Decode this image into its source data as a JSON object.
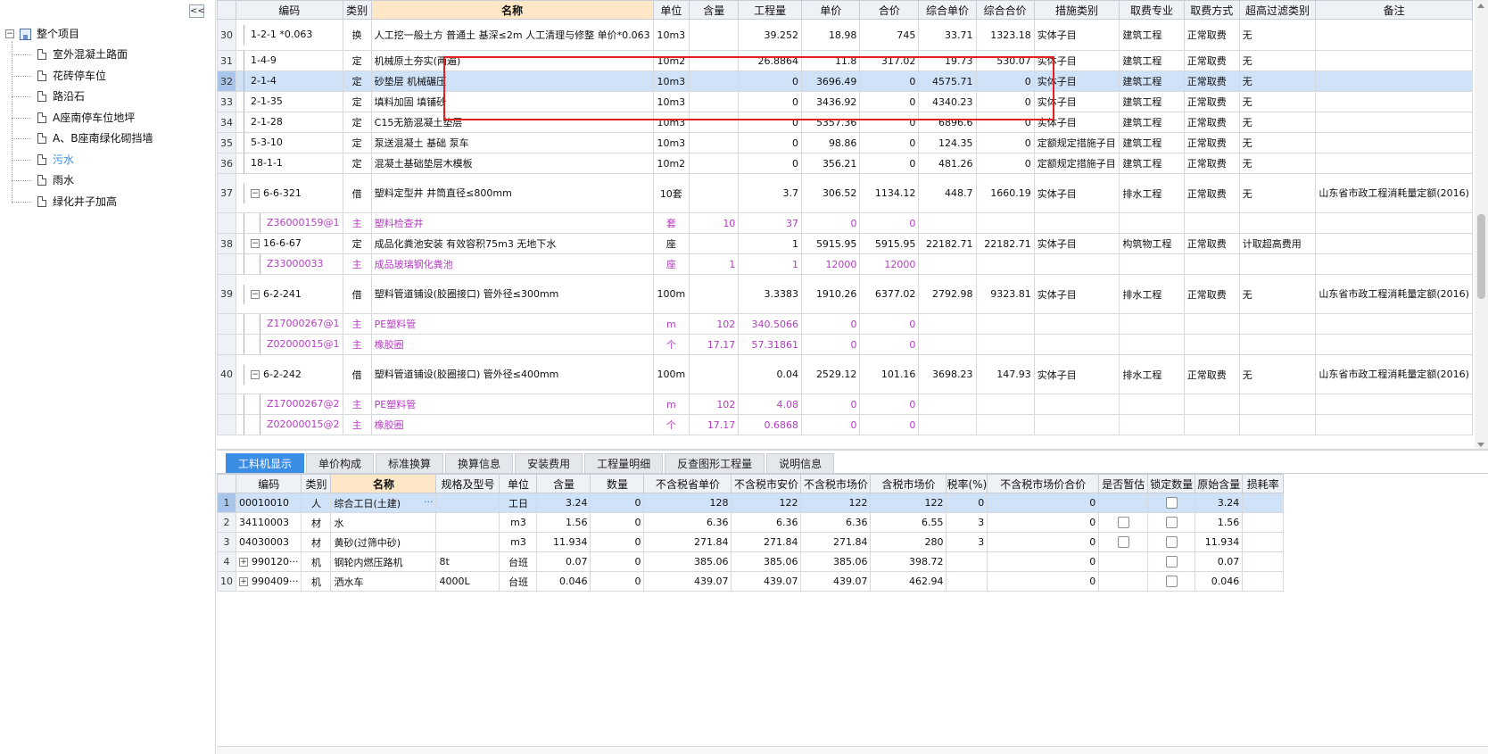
{
  "tree": {
    "collapse_label": "<<",
    "root": "整个项目",
    "items": [
      {
        "label": "室外混凝土路面",
        "active": false
      },
      {
        "label": "花砖停车位",
        "active": false
      },
      {
        "label": "路沿石",
        "active": false
      },
      {
        "label": "A座南停车位地坪",
        "active": false
      },
      {
        "label": "A、B座南绿化砌挡墙",
        "active": false
      },
      {
        "label": "污水",
        "active": true
      },
      {
        "label": "雨水",
        "active": false
      },
      {
        "label": "绿化井子加高",
        "active": false
      }
    ]
  },
  "upper_headers": [
    "",
    "编码",
    "类别",
    "名称",
    "单位",
    "含量",
    "工程量",
    "单价",
    "合价",
    "综合单价",
    "综合合价",
    "措施类别",
    "取费专业",
    "取费方式",
    "超高过滤类别",
    "备注"
  ],
  "upper_rows": [
    {
      "rn": "30",
      "code": "1-2-1 *0.063",
      "type": "换",
      "name": "人工挖一般土方 普通土 基深≤2m 人工清理与修整 单价*0.063",
      "unit": "10m3",
      "content": "",
      "qty": "39.252",
      "price": "18.98",
      "total": "745",
      "cprice": "33.71",
      "ctotal": "1323.18",
      "measure": "实体子目",
      "major": "建筑工程",
      "mode": "正常取费",
      "filter": "无",
      "note": "",
      "kind": "tall",
      "toggle": ""
    },
    {
      "rn": "31",
      "code": "1-4-9",
      "type": "定",
      "name": "机械原土夯实(两遍)",
      "unit": "10m2",
      "content": "",
      "qty": "26.8864",
      "price": "11.8",
      "total": "317.02",
      "cprice": "19.73",
      "ctotal": "530.07",
      "measure": "实体子目",
      "major": "建筑工程",
      "mode": "正常取费",
      "filter": "无",
      "note": "",
      "kind": "",
      "toggle": ""
    },
    {
      "rn": "32",
      "code": "2-1-4",
      "type": "定",
      "name": "砂垫层 机械碾压",
      "unit": "10m3",
      "content": "",
      "qty": "0",
      "price": "3696.49",
      "total": "0",
      "cprice": "4575.71",
      "ctotal": "0",
      "measure": "实体子目",
      "major": "建筑工程",
      "mode": "正常取费",
      "filter": "无",
      "note": "",
      "kind": "sel",
      "toggle": ""
    },
    {
      "rn": "33",
      "code": "2-1-35",
      "type": "定",
      "name": "填料加固 填铺砂",
      "unit": "10m3",
      "content": "",
      "qty": "0",
      "price": "3436.92",
      "total": "0",
      "cprice": "4340.23",
      "ctotal": "0",
      "measure": "实体子目",
      "major": "建筑工程",
      "mode": "正常取费",
      "filter": "无",
      "note": "",
      "kind": "",
      "toggle": ""
    },
    {
      "rn": "34",
      "code": "2-1-28",
      "type": "定",
      "name": "C15无筋混凝土垫层",
      "unit": "10m3",
      "content": "",
      "qty": "0",
      "price": "5357.36",
      "total": "0",
      "cprice": "6896.6",
      "ctotal": "0",
      "measure": "实体子目",
      "major": "建筑工程",
      "mode": "正常取费",
      "filter": "无",
      "note": "",
      "kind": "",
      "toggle": ""
    },
    {
      "rn": "35",
      "code": "5-3-10",
      "type": "定",
      "name": "泵送混凝土 基础 泵车",
      "unit": "10m3",
      "content": "",
      "qty": "0",
      "price": "98.86",
      "total": "0",
      "cprice": "124.35",
      "ctotal": "0",
      "measure": "定额规定措施子目",
      "major": "建筑工程",
      "mode": "正常取费",
      "filter": "无",
      "note": "",
      "kind": "",
      "toggle": ""
    },
    {
      "rn": "36",
      "code": "18-1-1",
      "type": "定",
      "name": "混凝土基础垫层木模板",
      "unit": "10m2",
      "content": "",
      "qty": "0",
      "price": "356.21",
      "total": "0",
      "cprice": "481.26",
      "ctotal": "0",
      "measure": "定额规定措施子目",
      "major": "建筑工程",
      "mode": "正常取费",
      "filter": "无",
      "note": "",
      "kind": "",
      "toggle": ""
    },
    {
      "rn": "37",
      "code": "6-6-321",
      "type": "借",
      "name": "塑料定型井 井筒直径≤800mm",
      "unit": "10套",
      "content": "",
      "qty": "3.7",
      "price": "306.52",
      "total": "1134.12",
      "cprice": "448.7",
      "ctotal": "1660.19",
      "measure": "实体子目",
      "major": "排水工程",
      "mode": "正常取费",
      "filter": "无",
      "note": "山东省市政工程消耗量定额(2016)",
      "kind": "tall",
      "toggle": "−"
    },
    {
      "rn": "",
      "code": "Z36000159@1",
      "type": "主",
      "name": "塑料检查井",
      "unit": "套",
      "content": "10",
      "qty": "37",
      "price": "0",
      "total": "0",
      "cprice": "",
      "ctotal": "",
      "measure": "",
      "major": "",
      "mode": "",
      "filter": "",
      "note": "",
      "kind": "sub",
      "toggle": ""
    },
    {
      "rn": "38",
      "code": "16-6-67",
      "type": "定",
      "name": "成品化粪池安装 有效容积75m3 无地下水",
      "unit": "座",
      "content": "",
      "qty": "1",
      "price": "5915.95",
      "total": "5915.95",
      "cprice": "22182.71",
      "ctotal": "22182.71",
      "measure": "实体子目",
      "major": "构筑物工程",
      "mode": "正常取费",
      "filter": "计取超高费用",
      "note": "",
      "kind": "",
      "toggle": "−"
    },
    {
      "rn": "",
      "code": "Z33000033",
      "type": "主",
      "name": "成品玻璃钢化粪池",
      "unit": "座",
      "content": "1",
      "qty": "1",
      "price": "12000",
      "total": "12000",
      "cprice": "",
      "ctotal": "",
      "measure": "",
      "major": "",
      "mode": "",
      "filter": "",
      "note": "",
      "kind": "sub",
      "toggle": ""
    },
    {
      "rn": "39",
      "code": "6-2-241",
      "type": "借",
      "name": "塑料管道铺设(胶圈接口) 管外径≤300mm",
      "unit": "100m",
      "content": "",
      "qty": "3.3383",
      "price": "1910.26",
      "total": "6377.02",
      "cprice": "2792.98",
      "ctotal": "9323.81",
      "measure": "实体子目",
      "major": "排水工程",
      "mode": "正常取费",
      "filter": "无",
      "note": "山东省市政工程消耗量定额(2016)",
      "kind": "tall",
      "toggle": "−"
    },
    {
      "rn": "",
      "code": "Z17000267@1",
      "type": "主",
      "name": "PE塑料管",
      "unit": "m",
      "content": "102",
      "qty": "340.5066",
      "price": "0",
      "total": "0",
      "cprice": "",
      "ctotal": "",
      "measure": "",
      "major": "",
      "mode": "",
      "filter": "",
      "note": "",
      "kind": "sub",
      "toggle": ""
    },
    {
      "rn": "",
      "code": "Z02000015@1",
      "type": "主",
      "name": "橡胶圈",
      "unit": "个",
      "content": "17.17",
      "qty": "57.31861",
      "price": "0",
      "total": "0",
      "cprice": "",
      "ctotal": "",
      "measure": "",
      "major": "",
      "mode": "",
      "filter": "",
      "note": "",
      "kind": "sub",
      "toggle": ""
    },
    {
      "rn": "40",
      "code": "6-2-242",
      "type": "借",
      "name": "塑料管道铺设(胶圈接口) 管外径≤400mm",
      "unit": "100m",
      "content": "",
      "qty": "0.04",
      "price": "2529.12",
      "total": "101.16",
      "cprice": "3698.23",
      "ctotal": "147.93",
      "measure": "实体子目",
      "major": "排水工程",
      "mode": "正常取费",
      "filter": "无",
      "note": "山东省市政工程消耗量定额(2016)",
      "kind": "tall",
      "toggle": "−"
    },
    {
      "rn": "",
      "code": "Z17000267@2",
      "type": "主",
      "name": "PE塑料管",
      "unit": "m",
      "content": "102",
      "qty": "4.08",
      "price": "0",
      "total": "0",
      "cprice": "",
      "ctotal": "",
      "measure": "",
      "major": "",
      "mode": "",
      "filter": "",
      "note": "",
      "kind": "sub",
      "toggle": ""
    },
    {
      "rn": "",
      "code": "Z02000015@2",
      "type": "主",
      "name": "橡胶圈",
      "unit": "个",
      "content": "17.17",
      "qty": "0.6868",
      "price": "0",
      "total": "0",
      "cprice": "",
      "ctotal": "",
      "measure": "",
      "major": "",
      "mode": "",
      "filter": "",
      "note": "",
      "kind": "sub",
      "toggle": ""
    }
  ],
  "tabs": [
    {
      "label": "工料机显示",
      "active": true
    },
    {
      "label": "单价构成",
      "active": false
    },
    {
      "label": "标准换算",
      "active": false
    },
    {
      "label": "换算信息",
      "active": false
    },
    {
      "label": "安装费用",
      "active": false
    },
    {
      "label": "工程量明细",
      "active": false
    },
    {
      "label": "反查图形工程量",
      "active": false
    },
    {
      "label": "说明信息",
      "active": false
    }
  ],
  "lower_headers": [
    "",
    "编码",
    "类别",
    "名称",
    "规格及型号",
    "单位",
    "含量",
    "数量",
    "不含税省单价",
    "不含税市安价",
    "不含税市场价",
    "含税市场价",
    "税率(%)",
    "不含税市场价合价",
    "是否暂估",
    "锁定数量",
    "原始含量",
    "损耗率"
  ],
  "lower_rows": [
    {
      "rn": "1",
      "code": "00010010",
      "type": "人",
      "name": "综合工日(土建)",
      "spec": "",
      "unit": "工日",
      "content": "3.24",
      "qty": "0",
      "p1": "128",
      "p2": "122",
      "p3": "122",
      "p4": "122",
      "tax": "0",
      "total": "0",
      "est": false,
      "lock": true,
      "orig": "3.24",
      "loss": "",
      "sel": true,
      "toggle": "",
      "more": "···"
    },
    {
      "rn": "2",
      "code": "34110003",
      "type": "材",
      "name": "水",
      "spec": "",
      "unit": "m3",
      "content": "1.56",
      "qty": "0",
      "p1": "6.36",
      "p2": "6.36",
      "p3": "6.36",
      "p4": "6.55",
      "tax": "3",
      "total": "0",
      "est": true,
      "lock": true,
      "orig": "1.56",
      "loss": "",
      "sel": false,
      "toggle": "",
      "more": ""
    },
    {
      "rn": "3",
      "code": "04030003",
      "type": "材",
      "name": "黄砂(过筛中砂)",
      "spec": "",
      "unit": "m3",
      "content": "11.934",
      "qty": "0",
      "p1": "271.84",
      "p2": "271.84",
      "p3": "271.84",
      "p4": "280",
      "tax": "3",
      "total": "0",
      "est": true,
      "lock": true,
      "orig": "11.934",
      "loss": "",
      "sel": false,
      "toggle": "",
      "more": ""
    },
    {
      "rn": "4",
      "code": "990120···",
      "type": "机",
      "name": "钢轮内燃压路机",
      "spec": "8t",
      "unit": "台班",
      "content": "0.07",
      "qty": "0",
      "p1": "385.06",
      "p2": "385.06",
      "p3": "385.06",
      "p4": "398.72",
      "tax": "",
      "total": "0",
      "est": false,
      "lock": true,
      "orig": "0.07",
      "loss": "",
      "sel": false,
      "toggle": "+",
      "more": ""
    },
    {
      "rn": "10",
      "code": "990409···",
      "type": "机",
      "name": "洒水车",
      "spec": "4000L",
      "unit": "台班",
      "content": "0.046",
      "qty": "0",
      "p1": "439.07",
      "p2": "439.07",
      "p3": "439.07",
      "p4": "462.94",
      "tax": "",
      "total": "0",
      "est": false,
      "lock": true,
      "orig": "0.046",
      "loss": "",
      "sel": false,
      "toggle": "+",
      "more": ""
    }
  ],
  "colors": {
    "accent": "#3a8ee6",
    "highlight_red": "#e22020",
    "sub_item": "#b43cc2",
    "selection": "#cfe2f7"
  }
}
